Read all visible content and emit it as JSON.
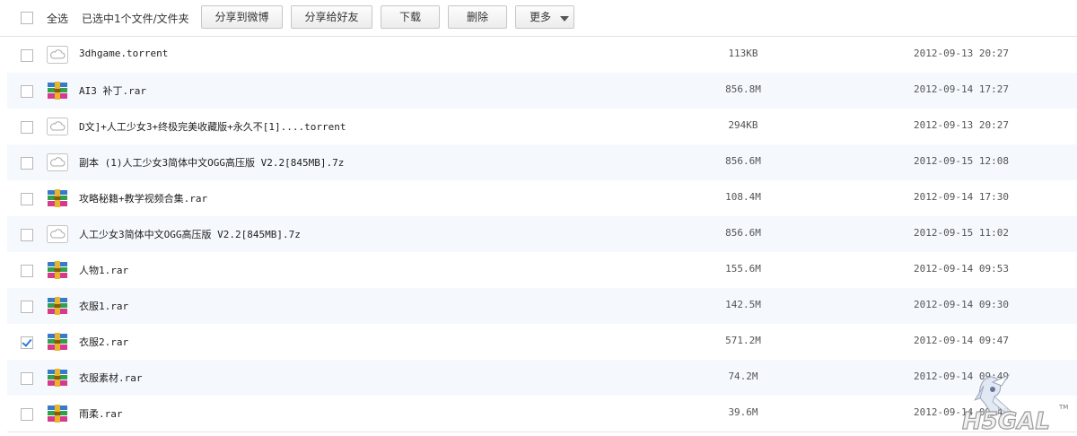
{
  "toolbar": {
    "select_all_label": "全选",
    "selection_status": "已选中1个文件/文件夹",
    "share_weibo_label": "分享到微博",
    "share_friends_label": "分享给好友",
    "download_label": "下载",
    "delete_label": "删除",
    "more_label": "更多"
  },
  "files": [
    {
      "name": "3dhgame.torrent",
      "size": "113KB",
      "date": "2012-09-13 20:27",
      "type": "cloud-file-icon",
      "checked": false
    },
    {
      "name": "AI3 补丁.rar",
      "size": "856.8M",
      "date": "2012-09-14 17:27",
      "type": "rar-archive-icon",
      "checked": false
    },
    {
      "name": "D文]+人工少女3+终极完美收藏版+永久不[1]....torrent",
      "size": "294KB",
      "date": "2012-09-13 20:27",
      "type": "cloud-file-icon",
      "checked": false
    },
    {
      "name": "副本 (1)人工少女3简体中文OGG高压版 V2.2[845MB].7z",
      "size": "856.6M",
      "date": "2012-09-15 12:08",
      "type": "cloud-file-icon",
      "checked": false
    },
    {
      "name": "攻略秘籍+教学视频合集.rar",
      "size": "108.4M",
      "date": "2012-09-14 17:30",
      "type": "rar-archive-icon",
      "checked": false
    },
    {
      "name": "人工少女3简体中文OGG高压版 V2.2[845MB].7z",
      "size": "856.6M",
      "date": "2012-09-15 11:02",
      "type": "cloud-file-icon",
      "checked": false
    },
    {
      "name": "人物1.rar",
      "size": "155.6M",
      "date": "2012-09-14 09:53",
      "type": "rar-archive-icon",
      "checked": false
    },
    {
      "name": "衣服1.rar",
      "size": "142.5M",
      "date": "2012-09-14 09:30",
      "type": "rar-archive-icon",
      "checked": false
    },
    {
      "name": "衣服2.rar",
      "size": "571.2M",
      "date": "2012-09-14 09:47",
      "type": "rar-archive-icon",
      "checked": true
    },
    {
      "name": "衣服素材.rar",
      "size": "74.2M",
      "date": "2012-09-14 09:49",
      "type": "rar-archive-icon",
      "checked": false
    },
    {
      "name": "雨柔.rar",
      "size": "39.6M",
      "date": "2012-09-14 09:48",
      "type": "rar-archive-icon",
      "checked": false
    }
  ],
  "watermark": {
    "text": "H5GAL",
    "mark": "TM"
  },
  "colors": {
    "check_blue": "#2d7bd4",
    "alt_row": "#f5f9fd",
    "border": "#e6e6e6"
  }
}
